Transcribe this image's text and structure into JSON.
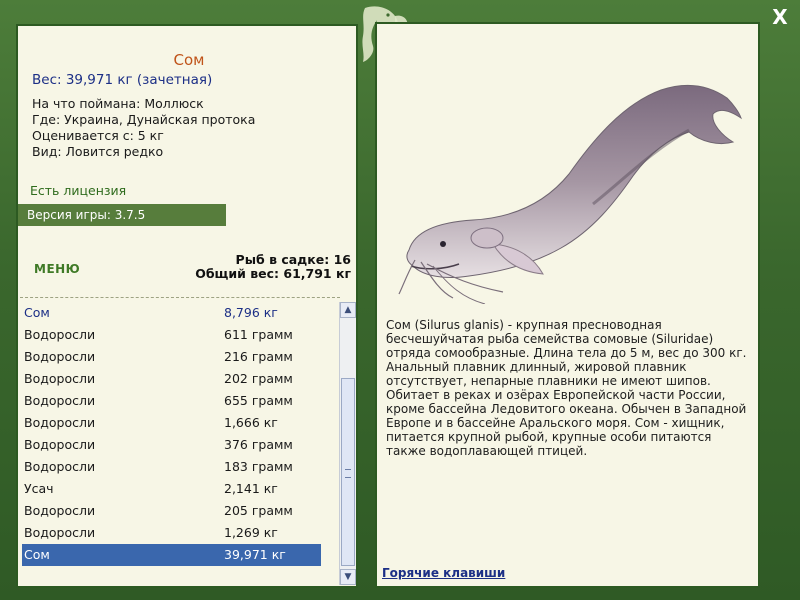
{
  "window": {
    "close_label": "X"
  },
  "fish": {
    "title": "Сом",
    "weight_line": "Вес: 39,971 кг (зачетная)",
    "caught_on": "На что поймана: Моллюск",
    "location": "Где: Украина, Дунайская протока",
    "rated_from": "Оценивается с: 5 кг",
    "kind": "Вид: Ловится редко"
  },
  "license": "Есть лицензия",
  "version": "Версия игры: 3.7.5",
  "menu_label": "МЕНЮ",
  "stats": {
    "fish_count": "Рыб в садке: 16",
    "total_weight": "Общий вес: 61,791 кг"
  },
  "catch_list": [
    {
      "name": "Сом",
      "weight": "8,796 кг"
    },
    {
      "name": "Водоросли",
      "weight": "611 грамм"
    },
    {
      "name": "Водоросли",
      "weight": "216 грамм"
    },
    {
      "name": "Водоросли",
      "weight": "202 грамм"
    },
    {
      "name": "Водоросли",
      "weight": "655 грамм"
    },
    {
      "name": "Водоросли",
      "weight": "1,666 кг"
    },
    {
      "name": "Водоросли",
      "weight": "376 грамм"
    },
    {
      "name": "Водоросли",
      "weight": "183 грамм"
    },
    {
      "name": "Усач",
      "weight": "2,141 кг"
    },
    {
      "name": "Водоросли",
      "weight": "205 грамм"
    },
    {
      "name": "Водоросли",
      "weight": "1,269 кг"
    },
    {
      "name": "Сом",
      "weight": "39,971 кг"
    }
  ],
  "description": "Сом (Silurus glanis) - крупная пресноводная бесчешуйчатая рыба семейства сомовые (Siluridae) отряда сомообразные. Длина тела до 5 м, вес до 300 кг. Анальный плавник длинный, жировой плавник отсутствует, непарные плавники не имеют шипов. Обитает в реках и озёрах Европейской части России, кроме бассейна Ледовитого океана. Обычен в Западной Европе и в бассейне Аральского моря. Сом - хищник, питается крупной рыбой, крупные особи питаются также водоплавающей птицей.",
  "hotkeys_label": "Горячие клавиши",
  "colors": {
    "frame": "#3e6a2f",
    "panel": "#f7f6e6",
    "selected_row": "#3a67ad",
    "title": "#c0541a",
    "accent_text": "#1c2f86"
  }
}
